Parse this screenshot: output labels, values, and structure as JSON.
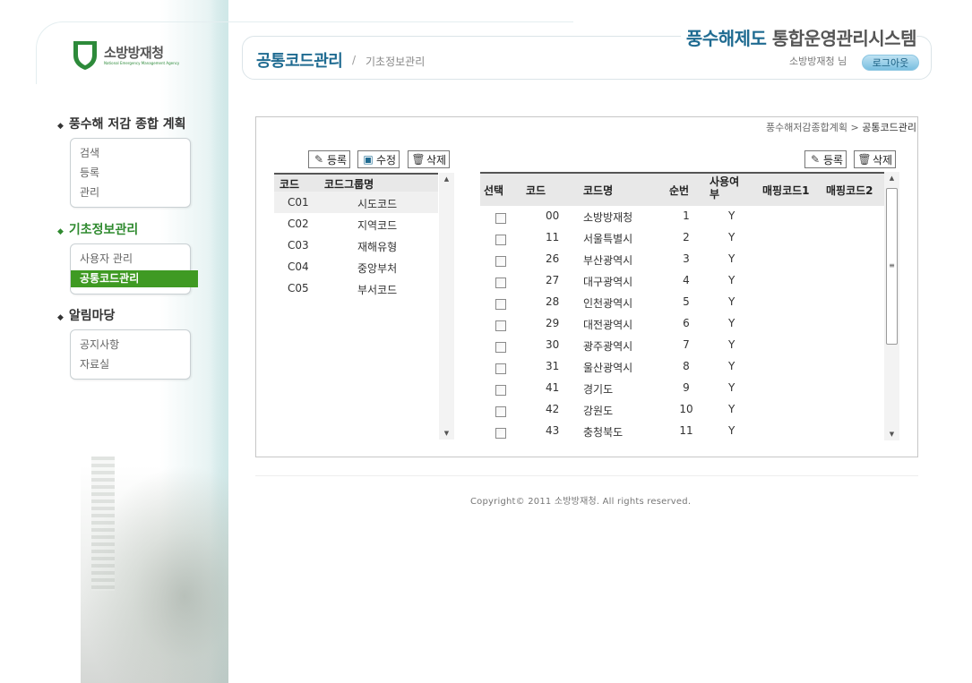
{
  "logo": {
    "name": "소방방재청",
    "sub": "National Emergency Management Agency"
  },
  "header": {
    "title": "공통코드관리",
    "separator": "/",
    "subtitle": "기초정보관리",
    "system_title_accent": "풍수해제도",
    "system_title_rest": " 통합운영관리시스템",
    "user": "소방방재청 님",
    "logout_label": "로그아웃"
  },
  "sidebar": {
    "sections": [
      {
        "title": "풍수해 저감 종합 계획",
        "items": [
          "검색",
          "등록",
          "관리"
        ]
      },
      {
        "title": "기초정보관리",
        "items": [
          "사용자 관리",
          "공통코드관리"
        ],
        "selected": "공통코드관리"
      },
      {
        "title": "알림마당",
        "items": [
          "공지사항",
          "자료실"
        ]
      }
    ]
  },
  "breadcrumb": {
    "path": "풍수해저감종합계획",
    "sep": ">",
    "current": "공통코드관리"
  },
  "left_toolbar": {
    "register": "등록",
    "edit": "수정",
    "delete": "삭제"
  },
  "right_toolbar": {
    "register": "등록",
    "delete": "삭제"
  },
  "group_grid": {
    "columns": [
      "코드",
      "코드그룹명"
    ],
    "rows": [
      {
        "code": "C01",
        "name": "시도코드"
      },
      {
        "code": "C02",
        "name": "지역코드"
      },
      {
        "code": "C03",
        "name": "재해유형"
      },
      {
        "code": "C04",
        "name": "중앙부처"
      },
      {
        "code": "C05",
        "name": "부서코드"
      }
    ]
  },
  "code_grid": {
    "columns": [
      "선택",
      "코드",
      "코드명",
      "순번",
      "사용여부",
      "매핑코드1",
      "매핑코드2"
    ],
    "rows": [
      {
        "code": "00",
        "name": "소방방재청",
        "order": "1",
        "use": "Y"
      },
      {
        "code": "11",
        "name": "서울특별시",
        "order": "2",
        "use": "Y"
      },
      {
        "code": "26",
        "name": "부산광역시",
        "order": "3",
        "use": "Y"
      },
      {
        "code": "27",
        "name": "대구광역시",
        "order": "4",
        "use": "Y"
      },
      {
        "code": "28",
        "name": "인천광역시",
        "order": "5",
        "use": "Y"
      },
      {
        "code": "29",
        "name": "대전광역시",
        "order": "6",
        "use": "Y"
      },
      {
        "code": "30",
        "name": "광주광역시",
        "order": "7",
        "use": "Y"
      },
      {
        "code": "31",
        "name": "울산광역시",
        "order": "8",
        "use": "Y"
      },
      {
        "code": "41",
        "name": "경기도",
        "order": "9",
        "use": "Y"
      },
      {
        "code": "42",
        "name": "강원도",
        "order": "10",
        "use": "Y"
      },
      {
        "code": "43",
        "name": "충청북도",
        "order": "11",
        "use": "Y"
      }
    ]
  },
  "footer": {
    "copyright": "Copyright© 2011 소방방재청. All rights reserved."
  },
  "colors": {
    "brand_blue": "#1f6b91",
    "menu_green": "#3f9a23",
    "logo_green": "#2d8a3a"
  }
}
